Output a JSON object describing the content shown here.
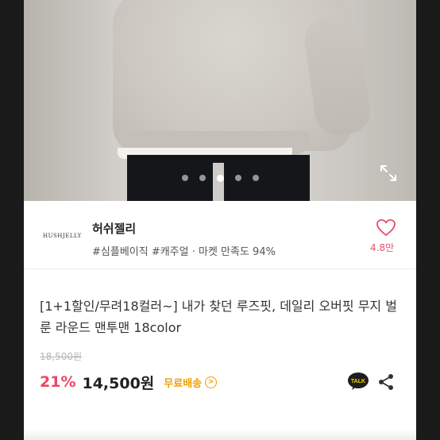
{
  "gallery": {
    "dots": [
      false,
      false,
      true,
      false,
      false
    ],
    "expand_icon": "expand-icon"
  },
  "shop": {
    "logo_text": "HUSHJELLY",
    "name": "허쉬젤리",
    "tags": "#심플베이직 #캐주얼 · 마켓 만족도 94%",
    "likes": "4.8만"
  },
  "product": {
    "title": "[1+1할인/무려18컬러~] 내가 찾던 루즈핏, 데일리 오버핏 무지 벌룬 라운드 맨투맨 18color",
    "original_price": "18,500원",
    "discount": "21%",
    "price": "14,500원",
    "shipping": "무료배송",
    "talk_label": "TALK"
  },
  "colors": {
    "accent_pink": "#ef4468",
    "shipping_orange": "#f0a000"
  }
}
